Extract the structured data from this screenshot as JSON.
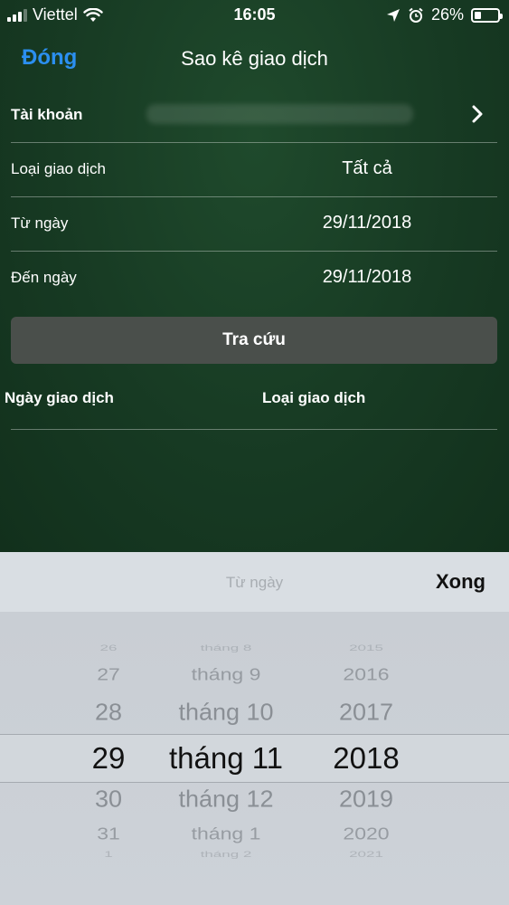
{
  "status_bar": {
    "carrier": "Viettel",
    "time": "16:05",
    "battery": "26%",
    "battery_level": 0.26
  },
  "nav": {
    "close_label": "Đóng",
    "title": "Sao kê giao dịch"
  },
  "form": {
    "account_label": "Tài khoản",
    "type_label": "Loại giao dịch",
    "type_value": "Tất cả",
    "from_label": "Từ ngày",
    "from_value": "29/11/2018",
    "to_label": "Đến ngày",
    "to_value": "29/11/2018"
  },
  "search_button": "Tra cứu",
  "table_headers": {
    "date": "Ngày giao dịch",
    "type": "Loại giao dịch"
  },
  "picker": {
    "title": "Từ ngày",
    "done_label": "Xong",
    "days": [
      "26",
      "27",
      "28",
      "29",
      "30",
      "31",
      "1"
    ],
    "months": [
      "tháng 8",
      "tháng 9",
      "tháng 10",
      "tháng 11",
      "tháng 12",
      "tháng 1",
      "tháng 2"
    ],
    "years": [
      "2015",
      "2016",
      "2017",
      "2018",
      "2019",
      "2020",
      "2021"
    ],
    "selected_index": 3
  }
}
